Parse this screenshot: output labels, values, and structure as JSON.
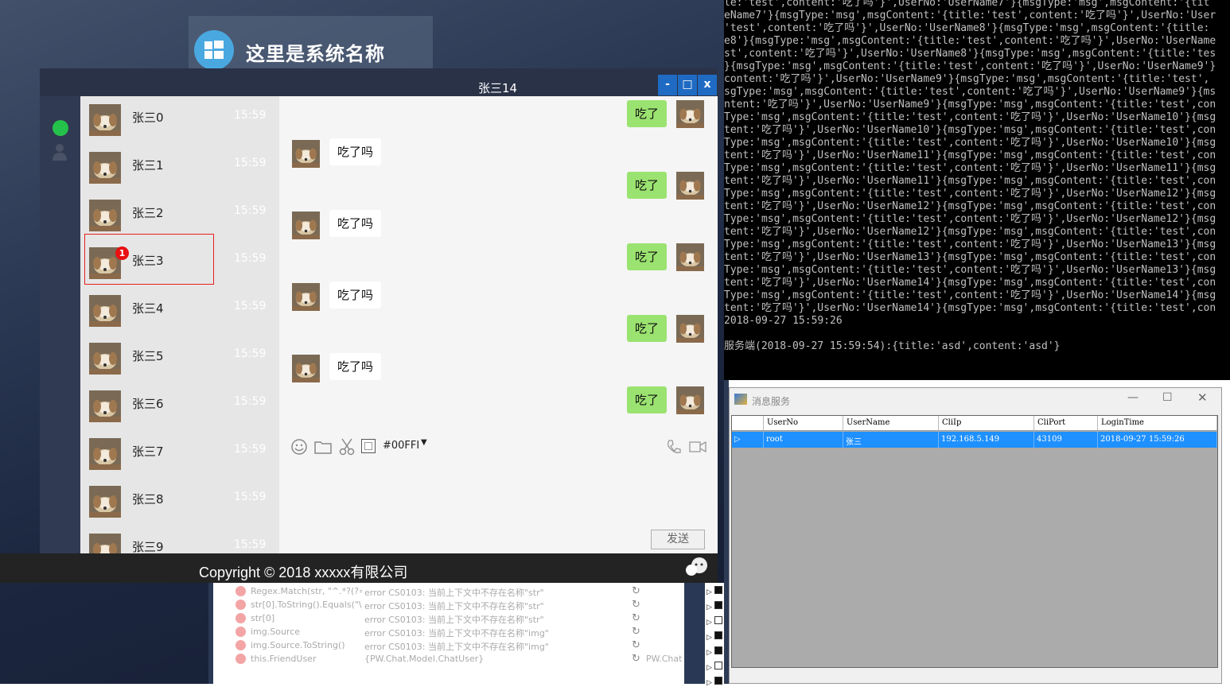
{
  "banner": {
    "title": "这里是系统名称"
  },
  "chat_window": {
    "title": "张三14",
    "minimize_label": "-",
    "maximize_label": "□",
    "close_label": "x"
  },
  "contacts": [
    {
      "name": "张三0",
      "time": "15:59"
    },
    {
      "name": "张三1",
      "time": "15:59"
    },
    {
      "name": "张三2",
      "time": "15:59"
    },
    {
      "name": "张三3",
      "time": "15:59",
      "unread": "1"
    },
    {
      "name": "张三4",
      "time": "15:59"
    },
    {
      "name": "张三5",
      "time": "15:59"
    },
    {
      "name": "张三6",
      "time": "15:59"
    },
    {
      "name": "张三7",
      "time": "15:59"
    },
    {
      "name": "张三8",
      "time": "15:59"
    },
    {
      "name": "张三9",
      "time": "15:59"
    }
  ],
  "messages": [
    {
      "side": "right",
      "text": "吃了"
    },
    {
      "side": "left",
      "text": "吃了吗"
    },
    {
      "side": "right",
      "text": "吃了"
    },
    {
      "side": "left",
      "text": "吃了吗"
    },
    {
      "side": "right",
      "text": "吃了"
    },
    {
      "side": "left",
      "text": "吃了吗"
    },
    {
      "side": "right",
      "text": "吃了"
    },
    {
      "side": "left",
      "text": "吃了吗"
    },
    {
      "side": "right",
      "text": "吃了"
    }
  ],
  "toolbar": {
    "color_value": "#00FFI",
    "send_label": "发送"
  },
  "footer": {
    "copyright": "Copyright © 2018 xxxxx有限公司"
  },
  "debug_rows": [
    {
      "name": "Regex.Match(str, \"^.*?(?=\\",
      "value": "error CS0103: 当前上下文中不存在名称\"str\""
    },
    {
      "name": "str[0].ToString().Equals(\"\\r",
      "value": "error CS0103: 当前上下文中不存在名称\"str\""
    },
    {
      "name": "str[0]",
      "value": "error CS0103: 当前上下文中不存在名称\"str\""
    },
    {
      "name": "img.Source",
      "value": "error CS0103: 当前上下文中不存在名称\"img\""
    },
    {
      "name": "img.Source.ToString()",
      "value": "error CS0103: 当前上下文中不存在名称\"img\""
    },
    {
      "name": "this.FriendUser",
      "value": "{PW.Chat.Model.ChatUser}",
      "type": "PW.Chat"
    }
  ],
  "console_lines": [
    "le:'test',content:'吃了吗'}',UserNo:'UserName7'}{msgType:'msg',msgContent:'{tit",
    "eName7'}{msgType:'msg',msgContent:'{title:'test',content:'吃了吗'}',UserNo:'User",
    "'test',content:'吃了吗'}',UserNo:'UserName8'}{msgType:'msg',msgContent:'{title:",
    "e8'}{msgType:'msg',msgContent:'{title:'test',content:'吃了吗'}',UserNo:'UserName",
    "st',content:'吃了吗'}',UserNo:'UserName8'}{msgType:'msg',msgContent:'{title:'tes",
    "}{msgType:'msg',msgContent:'{title:'test',content:'吃了吗'}',UserNo:'UserName9'}",
    "content:'吃了吗'}',UserNo:'UserName9'}{msgType:'msg',msgContent:'{title:'test',",
    "sgType:'msg',msgContent:'{title:'test',content:'吃了吗'}',UserNo:'UserName9'}{ms",
    "ntent:'吃了吗'}',UserNo:'UserName9'}{msgType:'msg',msgContent:'{title:'test',con",
    "Type:'msg',msgContent:'{title:'test',content:'吃了吗'}',UserNo:'UserName10'}{msg",
    "tent:'吃了吗'}',UserNo:'UserName10'}{msgType:'msg',msgContent:'{title:'test',con",
    "Type:'msg',msgContent:'{title:'test',content:'吃了吗'}',UserNo:'UserName10'}{msg",
    "tent:'吃了吗'}',UserNo:'UserName11'}{msgType:'msg',msgContent:'{title:'test',con",
    "Type:'msg',msgContent:'{title:'test',content:'吃了吗'}',UserNo:'UserName11'}{msg",
    "tent:'吃了吗'}',UserNo:'UserName11'}{msgType:'msg',msgContent:'{title:'test',con",
    "Type:'msg',msgContent:'{title:'test',content:'吃了吗'}',UserNo:'UserName12'}{msg",
    "tent:'吃了吗'}',UserNo:'UserName12'}{msgType:'msg',msgContent:'{title:'test',con",
    "Type:'msg',msgContent:'{title:'test',content:'吃了吗'}',UserNo:'UserName12'}{msg",
    "tent:'吃了吗'}',UserNo:'UserName12'}{msgType:'msg',msgContent:'{title:'test',con",
    "Type:'msg',msgContent:'{title:'test',content:'吃了吗'}',UserNo:'UserName13'}{msg",
    "tent:'吃了吗'}',UserNo:'UserName13'}{msgType:'msg',msgContent:'{title:'test',con",
    "Type:'msg',msgContent:'{title:'test',content:'吃了吗'}',UserNo:'UserName13'}{msg",
    "tent:'吃了吗'}',UserNo:'UserName14'}{msgType:'msg',msgContent:'{title:'test',con",
    "Type:'msg',msgContent:'{title:'test',content:'吃了吗'}',UserNo:'UserName14'}{msg",
    "tent:'吃了吗'}',UserNo:'UserName14'}{msgType:'msg',msgContent:'{title:'test',con",
    "2018-09-27 15:59:26",
    "",
    "服务端(2018-09-27 15:59:54):{title:'asd',content:'asd'}"
  ],
  "msg_service": {
    "title": "消息服务",
    "columns": [
      "UserNo",
      "UserName",
      "CliIp",
      "CliPort",
      "LoginTime"
    ],
    "row": [
      "root",
      "张三",
      "192.168.5.149",
      "43109",
      "2018-09-27 15:59:26"
    ]
  },
  "colors": {
    "bubble_right": "#9be370",
    "selection": "#1e90ff",
    "badge": "#e81010"
  }
}
